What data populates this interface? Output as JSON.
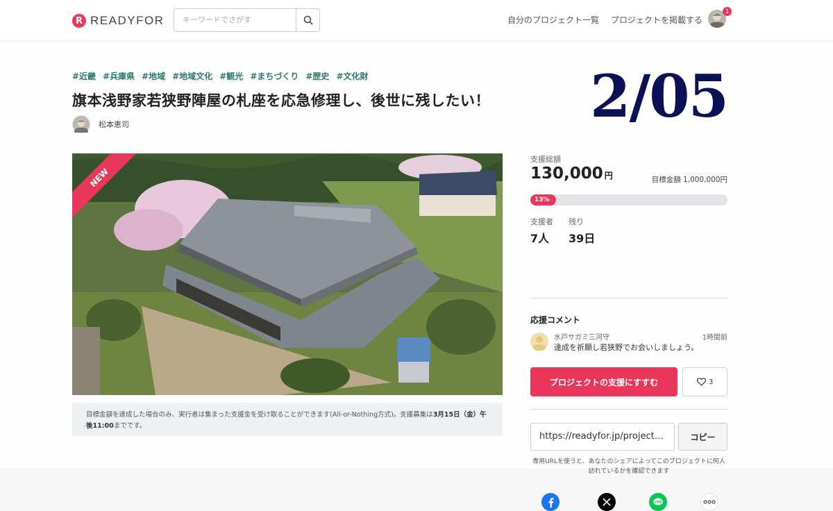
{
  "header": {
    "logo_text": "READYFOR",
    "logo_mark": "R",
    "search_placeholder": "キーワードでさがす",
    "nav_my_projects": "自分のプロジェクト一覧",
    "nav_post_project": "プロジェクトを掲載する",
    "notification_count": "1"
  },
  "project": {
    "tags": [
      "#近畿",
      "#兵庫県",
      "#地域",
      "#地域文化",
      "#観光",
      "#まちづくり",
      "#歴史",
      "#文化財"
    ],
    "title": "旗本浅野家若狭野陣屋の札座を応急修理し、後世に残したい！",
    "owner_name": "松本恵司",
    "badge": "NEW",
    "overlay_date": "2/05",
    "notice_pre": "目標金額を達成した場合のみ、実行者は集まった支援金を受け取ることができます(All-or-Nothing方式)。支援募集は",
    "notice_date": "3月15日（金）午後11:00",
    "notice_post": "までです。"
  },
  "stats": {
    "total_label": "支援総額",
    "total_value": "130,000",
    "total_unit": "円",
    "goal_label": "目標金額",
    "goal_value": "1,000,000円",
    "progress_percent": 13,
    "progress_text": "13%",
    "supporters_label": "支援者",
    "supporters_value": "7人",
    "remaining_label": "残り",
    "remaining_value": "39日"
  },
  "comments": {
    "heading": "応援コメント",
    "items": [
      {
        "name": "水戸サガミ三河守",
        "time": "1時間前",
        "text": "達成を祈願し若狭野でお会いしましょう。"
      }
    ]
  },
  "actions": {
    "support_label": "プロジェクトの支援にすすむ",
    "like_count": "3",
    "url_value": "https://readyfor.jp/projects/...",
    "copy_label": "コピー",
    "share_note": "専用URLを使うと、あなたのシェアによってこのプロジェクトに何人訪れているかを確認できます"
  },
  "social": [
    "facebook-icon",
    "x-icon",
    "line-icon",
    "note-icon"
  ],
  "colors": {
    "accent": "#e8375a",
    "tag": "#2e7a6e",
    "date_overlay": "#0c1055"
  }
}
